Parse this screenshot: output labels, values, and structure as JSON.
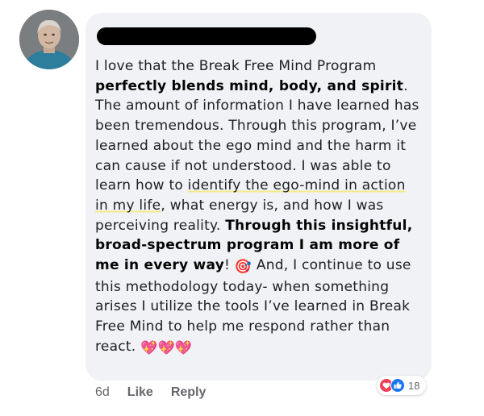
{
  "comment": {
    "author_name": "",
    "segments": [
      {
        "text": "I love that the Break Free Mind Program ",
        "style": "normal"
      },
      {
        "text": "perfectly blends mind, body, and spirit",
        "style": "bold"
      },
      {
        "text": ". The amount of information I have learned has been tremendous. Through this program, I’ve learned about the ego mind and the harm it can cause if not understood. I was able to learn how to ",
        "style": "normal"
      },
      {
        "text": "identify the ego-mind in action in my life",
        "style": "highlight"
      },
      {
        "text": ", what energy is, and how I was perceiving reality. ",
        "style": "normal"
      },
      {
        "text": "Through this insightful, broad-spectrum program I am more of me in every way",
        "style": "bold"
      },
      {
        "text": "! ",
        "style": "normal"
      },
      {
        "text": "🎯",
        "style": "emoji"
      },
      {
        "text": " And, I continue to use this methodology today- when something arises I utilize the tools I’ve learned in Break Free Mind to help me respond rather than react. ",
        "style": "normal"
      },
      {
        "text": "💖💖💖",
        "style": "emoji"
      }
    ]
  },
  "reactions": {
    "icons": [
      "love-icon",
      "like-icon"
    ],
    "count": "18"
  },
  "actions": {
    "age": "6d",
    "like_label": "Like",
    "reply_label": "Reply"
  },
  "colors": {
    "bubble": "#f0f2f5",
    "text": "#1c1e21",
    "meta": "#65676b",
    "highlight": "#f2ea8a",
    "like_blue": "#1877f2",
    "love_red": "#f33e58"
  }
}
